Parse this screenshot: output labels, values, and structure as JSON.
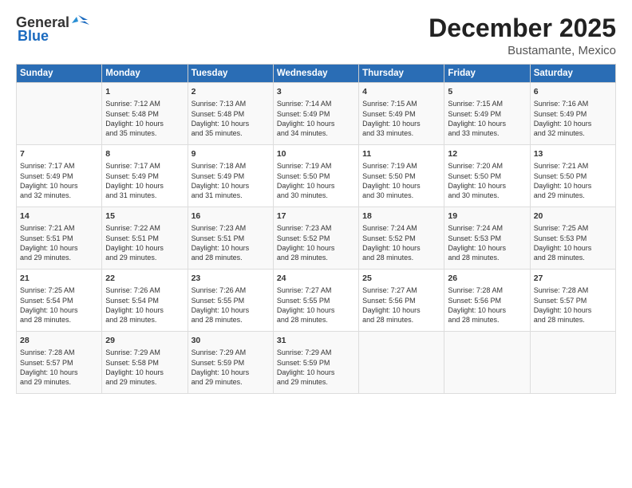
{
  "header": {
    "logo_general": "General",
    "logo_blue": "Blue",
    "title": "December 2025",
    "subtitle": "Bustamante, Mexico"
  },
  "days_of_week": [
    "Sunday",
    "Monday",
    "Tuesday",
    "Wednesday",
    "Thursday",
    "Friday",
    "Saturday"
  ],
  "weeks": [
    [
      {
        "day": "",
        "content": ""
      },
      {
        "day": "1",
        "content": "Sunrise: 7:12 AM\nSunset: 5:48 PM\nDaylight: 10 hours\nand 35 minutes."
      },
      {
        "day": "2",
        "content": "Sunrise: 7:13 AM\nSunset: 5:48 PM\nDaylight: 10 hours\nand 35 minutes."
      },
      {
        "day": "3",
        "content": "Sunrise: 7:14 AM\nSunset: 5:49 PM\nDaylight: 10 hours\nand 34 minutes."
      },
      {
        "day": "4",
        "content": "Sunrise: 7:15 AM\nSunset: 5:49 PM\nDaylight: 10 hours\nand 33 minutes."
      },
      {
        "day": "5",
        "content": "Sunrise: 7:15 AM\nSunset: 5:49 PM\nDaylight: 10 hours\nand 33 minutes."
      },
      {
        "day": "6",
        "content": "Sunrise: 7:16 AM\nSunset: 5:49 PM\nDaylight: 10 hours\nand 32 minutes."
      }
    ],
    [
      {
        "day": "7",
        "content": "Sunrise: 7:17 AM\nSunset: 5:49 PM\nDaylight: 10 hours\nand 32 minutes."
      },
      {
        "day": "8",
        "content": "Sunrise: 7:17 AM\nSunset: 5:49 PM\nDaylight: 10 hours\nand 31 minutes."
      },
      {
        "day": "9",
        "content": "Sunrise: 7:18 AM\nSunset: 5:49 PM\nDaylight: 10 hours\nand 31 minutes."
      },
      {
        "day": "10",
        "content": "Sunrise: 7:19 AM\nSunset: 5:50 PM\nDaylight: 10 hours\nand 30 minutes."
      },
      {
        "day": "11",
        "content": "Sunrise: 7:19 AM\nSunset: 5:50 PM\nDaylight: 10 hours\nand 30 minutes."
      },
      {
        "day": "12",
        "content": "Sunrise: 7:20 AM\nSunset: 5:50 PM\nDaylight: 10 hours\nand 30 minutes."
      },
      {
        "day": "13",
        "content": "Sunrise: 7:21 AM\nSunset: 5:50 PM\nDaylight: 10 hours\nand 29 minutes."
      }
    ],
    [
      {
        "day": "14",
        "content": "Sunrise: 7:21 AM\nSunset: 5:51 PM\nDaylight: 10 hours\nand 29 minutes."
      },
      {
        "day": "15",
        "content": "Sunrise: 7:22 AM\nSunset: 5:51 PM\nDaylight: 10 hours\nand 29 minutes."
      },
      {
        "day": "16",
        "content": "Sunrise: 7:23 AM\nSunset: 5:51 PM\nDaylight: 10 hours\nand 28 minutes."
      },
      {
        "day": "17",
        "content": "Sunrise: 7:23 AM\nSunset: 5:52 PM\nDaylight: 10 hours\nand 28 minutes."
      },
      {
        "day": "18",
        "content": "Sunrise: 7:24 AM\nSunset: 5:52 PM\nDaylight: 10 hours\nand 28 minutes."
      },
      {
        "day": "19",
        "content": "Sunrise: 7:24 AM\nSunset: 5:53 PM\nDaylight: 10 hours\nand 28 minutes."
      },
      {
        "day": "20",
        "content": "Sunrise: 7:25 AM\nSunset: 5:53 PM\nDaylight: 10 hours\nand 28 minutes."
      }
    ],
    [
      {
        "day": "21",
        "content": "Sunrise: 7:25 AM\nSunset: 5:54 PM\nDaylight: 10 hours\nand 28 minutes."
      },
      {
        "day": "22",
        "content": "Sunrise: 7:26 AM\nSunset: 5:54 PM\nDaylight: 10 hours\nand 28 minutes."
      },
      {
        "day": "23",
        "content": "Sunrise: 7:26 AM\nSunset: 5:55 PM\nDaylight: 10 hours\nand 28 minutes."
      },
      {
        "day": "24",
        "content": "Sunrise: 7:27 AM\nSunset: 5:55 PM\nDaylight: 10 hours\nand 28 minutes."
      },
      {
        "day": "25",
        "content": "Sunrise: 7:27 AM\nSunset: 5:56 PM\nDaylight: 10 hours\nand 28 minutes."
      },
      {
        "day": "26",
        "content": "Sunrise: 7:28 AM\nSunset: 5:56 PM\nDaylight: 10 hours\nand 28 minutes."
      },
      {
        "day": "27",
        "content": "Sunrise: 7:28 AM\nSunset: 5:57 PM\nDaylight: 10 hours\nand 28 minutes."
      }
    ],
    [
      {
        "day": "28",
        "content": "Sunrise: 7:28 AM\nSunset: 5:57 PM\nDaylight: 10 hours\nand 29 minutes."
      },
      {
        "day": "29",
        "content": "Sunrise: 7:29 AM\nSunset: 5:58 PM\nDaylight: 10 hours\nand 29 minutes."
      },
      {
        "day": "30",
        "content": "Sunrise: 7:29 AM\nSunset: 5:59 PM\nDaylight: 10 hours\nand 29 minutes."
      },
      {
        "day": "31",
        "content": "Sunrise: 7:29 AM\nSunset: 5:59 PM\nDaylight: 10 hours\nand 29 minutes."
      },
      {
        "day": "",
        "content": ""
      },
      {
        "day": "",
        "content": ""
      },
      {
        "day": "",
        "content": ""
      }
    ]
  ]
}
